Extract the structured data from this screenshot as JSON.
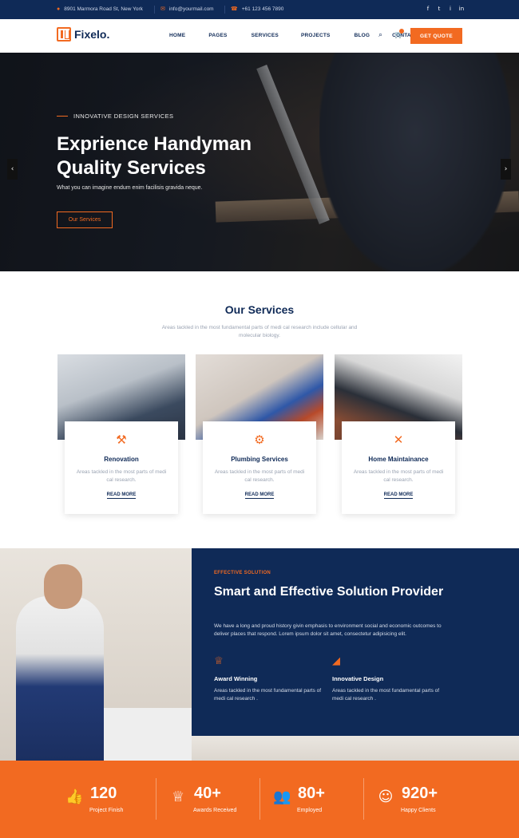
{
  "topbar": {
    "address": "8901 Marmora Road St, New York",
    "email": "info@yourmail.com",
    "phone": "+61 123 456 7890",
    "social": [
      "f",
      "t",
      "i",
      "in"
    ]
  },
  "nav": {
    "brand": "Fixelo.",
    "menu": [
      "HOME",
      "PAGES",
      "SERVICES",
      "PROJECTS",
      "BLOG",
      "CONTACT"
    ],
    "cta": "GET QUOTE",
    "icons": [
      "search-icon",
      "cart-icon"
    ]
  },
  "hero": {
    "eyebrow": "INNOVATIVE DESIGN SERVICES",
    "title_line1": "Exprience Handyman",
    "title_line2": "Quality Services",
    "subtitle": "What you can imagine endum enim facilisis gravida neque.",
    "button": "Our Services"
  },
  "services": {
    "title": "Our Services",
    "subtitle": "Areas tackled in the most fundamental parts of medi cal research include cellular and molecular biology.",
    "items": [
      {
        "name": "Renovation",
        "desc": "Areas tackled in the most parts of medi cal research.",
        "more": "READ MORE",
        "icon": "drill-icon"
      },
      {
        "name": "Plumbing Services",
        "desc": "Areas tackled in the most parts of medi cal research.",
        "more": "READ MORE",
        "icon": "pipe-icon"
      },
      {
        "name": "Home Maintainance",
        "desc": "Areas tackled in the most parts of medi cal research.",
        "more": "READ MORE",
        "icon": "tools-icon"
      }
    ]
  },
  "solution": {
    "eyebrow": "EFFECTIVE SOLUTION",
    "title": "Smart and Effective Solution Provider",
    "text": "We have a long and proud history givin emphasis to environment social and economic outcomes to deliver places that respond. Lorem ipsum dolor sit amet, consectetur adipisicing elit.",
    "features": [
      {
        "title": "Award Winning",
        "desc": "Areas tackled in the most fundamental parts of medi cal research .",
        "icon": "trophy-icon"
      },
      {
        "title": "Innovative Design",
        "desc": "Areas tackled in the most fundamental parts of medi cal research .",
        "icon": "design-ruler-icon"
      }
    ]
  },
  "stats": [
    {
      "number": "120",
      "label": "Project Finish",
      "icon": "thumbs-up-icon"
    },
    {
      "number": "40+",
      "label": "Awards Received",
      "icon": "trophy-icon"
    },
    {
      "number": "80+",
      "label": "Employed",
      "icon": "users-icon"
    },
    {
      "number": "920+",
      "label": "Happy Clients",
      "icon": "smile-icon"
    }
  ],
  "colors": {
    "navy": "#0f2a57",
    "orange": "#f26a21"
  }
}
